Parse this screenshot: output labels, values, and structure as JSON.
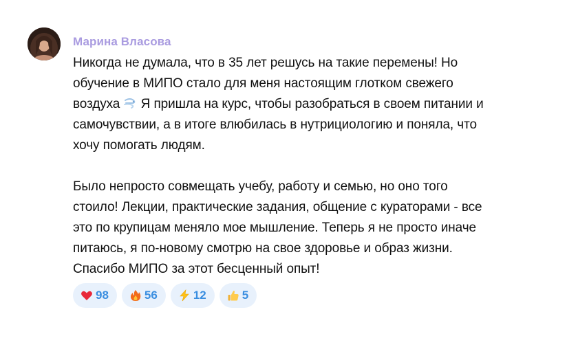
{
  "author": {
    "name": "Марина Власова",
    "name_color": "#a99be0"
  },
  "message": {
    "paragraph1": {
      "line1": "Никогда не думала, что в 35 лет решусь на такие перемены! Но",
      "line2": "обучение в МИПО стало для меня настоящим глотком свежего",
      "line3_before_emoji": "воздуха",
      "line3_emoji": "wind-face-icon",
      "line3_after_emoji": " Я пришла на курс, чтобы разобраться в своем питании и",
      "line4": "самочувствии, а в итоге влюбилась в нутрициологию и поняла, что",
      "line5": "хочу помогать людям."
    },
    "paragraph2": {
      "line1": "Было непросто совмещать учебу, работу и семью, но оно того",
      "line2": "стоило! Лекции, практические задания, общение с кураторами - все",
      "line3": "это по крупицам меняло мое мышление. Теперь я не просто иначе",
      "line4": "питаюсь, я по-новому смотрю на свое здоровье и образ жизни.",
      "line5": "Спасибо МИПО за этот бесценный опыт!"
    }
  },
  "reactions": [
    {
      "icon": "heart-icon",
      "count": "98"
    },
    {
      "icon": "fire-icon",
      "count": "56"
    },
    {
      "icon": "lightning-icon",
      "count": "12"
    },
    {
      "icon": "thumbs-up-icon",
      "count": "5"
    }
  ],
  "colors": {
    "reaction_bg": "#e8f1fc",
    "reaction_count": "#3a8ee0",
    "text": "#111111"
  }
}
